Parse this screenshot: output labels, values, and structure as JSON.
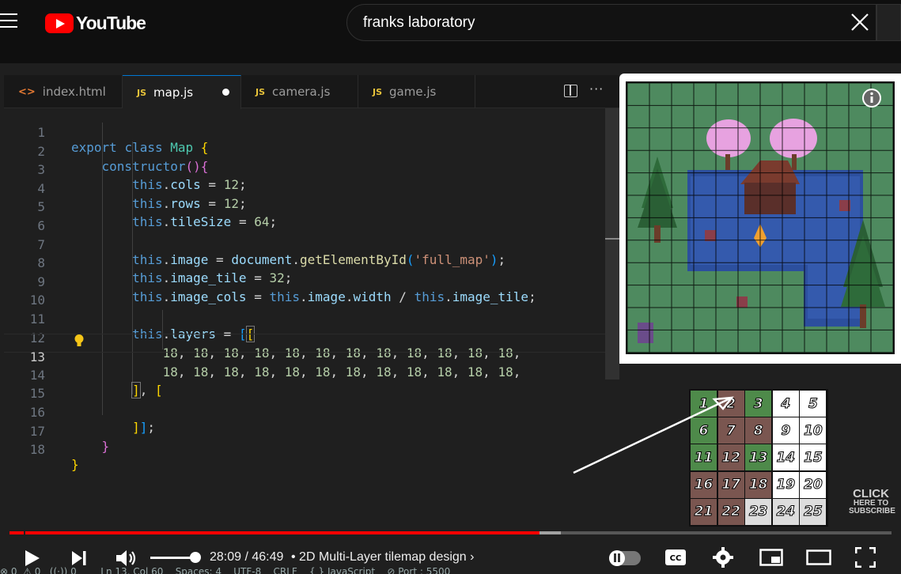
{
  "header": {
    "logo_text": "YouTube",
    "search_value": "franks laboratory"
  },
  "editor": {
    "tabs": [
      {
        "icon": "<>",
        "label": "index.html",
        "active": false
      },
      {
        "icon": "JS",
        "label": "map.js",
        "active": true,
        "modified": true
      },
      {
        "icon": "JS",
        "label": "camera.js",
        "active": false
      },
      {
        "icon": "JS",
        "label": "game.js",
        "active": false
      }
    ],
    "more_label": "···",
    "line_numbers": [
      "1",
      "2",
      "3",
      "4",
      "5",
      "6",
      "7",
      "8",
      "9",
      "10",
      "11",
      "12",
      "13",
      "14",
      "15",
      "16",
      "17",
      "18"
    ],
    "current_line": "13",
    "code_lines": [
      "export class Map {",
      "    constructor(){",
      "        this.cols = 12;",
      "        this.rows = 12;",
      "        this.tileSize = 64;",
      "",
      "        this.image = document.getElementById('full_map');",
      "        this.image_tile = 32;",
      "        this.image_cols = this.image.width / this.image_tile;",
      "",
      "        this.layers = [[",
      "            18, 18, 18, 18, 18, 18, 18, 18, 18, 18, 18, 18,",
      "            18, 18, 18, 18, 18, 18, 18, 18, 18, 18, 18, 18,",
      "        ], [",
      "",
      "        ]];",
      "    }",
      "}"
    ]
  },
  "tilesheet": {
    "tiles": [
      "1",
      "2",
      "3",
      "4",
      "5",
      "6",
      "7",
      "8",
      "9",
      "10",
      "11",
      "12",
      "13",
      "14",
      "15",
      "16",
      "17",
      "18",
      "19",
      "20",
      "21",
      "22",
      "23",
      "24",
      "25"
    ]
  },
  "subscribe": {
    "line1": "CLICK",
    "line2": "HERE TO",
    "line3": "SUBSCRIBE"
  },
  "player": {
    "current_time": "28:09",
    "duration": "46:49",
    "time_display": "28:09 / 46:49",
    "chapter_title": "• 2D Multi-Layer tilemap design",
    "played_fraction": 0.601,
    "buffered_fraction": 0.625
  },
  "status_bar": {
    "text": "⊗ 0  ⚠ 0   ((·)) 0        Ln 13, Col 60    Spaces: 4    UTF-8    CRLF    { } JavaScript    ⊘ Port : 5500"
  },
  "colors": {
    "yt_red": "#ff0000",
    "editor_bg": "#1f1f1f",
    "active_tab_accent": "#0078d4",
    "map_grass": "#4e8a5f",
    "map_water": "#2c4f9e"
  }
}
